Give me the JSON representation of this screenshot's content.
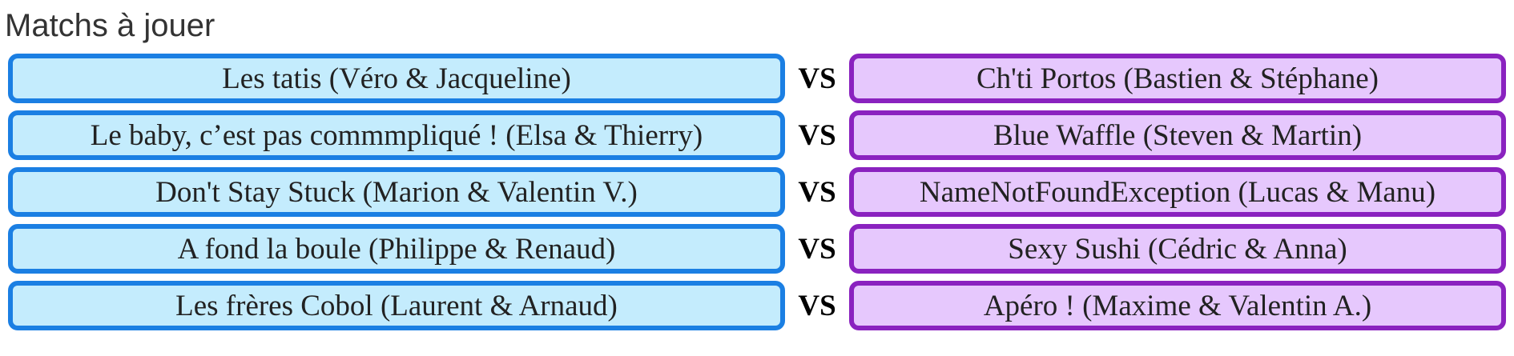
{
  "page": {
    "title": "Matchs à jouer"
  },
  "colors": {
    "home_border": "#1b7fe3",
    "home_fill": "#c4ecfd",
    "away_border": "#8a22bf",
    "away_fill": "#e6c8fd",
    "vs_text": "#000000"
  },
  "matches": [
    {
      "home": "Les tatis (Véro & Jacqueline)",
      "vs": "VS",
      "away": "Ch'ti Portos (Bastien & Stéphane)"
    },
    {
      "home": "Le baby, c’est pas commmpliqué ! (Elsa & Thierry)",
      "vs": "VS",
      "away": "Blue Waffle (Steven & Martin)"
    },
    {
      "home": "Don't Stay Stuck (Marion & Valentin V.)",
      "vs": "VS",
      "away": "NameNotFoundException (Lucas & Manu)"
    },
    {
      "home": "A fond la boule (Philippe & Renaud)",
      "vs": "VS",
      "away": "Sexy Sushi (Cédric & Anna)"
    },
    {
      "home": "Les frères Cobol (Laurent & Arnaud)",
      "vs": "VS",
      "away": "Apéro ! (Maxime & Valentin A.)"
    }
  ]
}
